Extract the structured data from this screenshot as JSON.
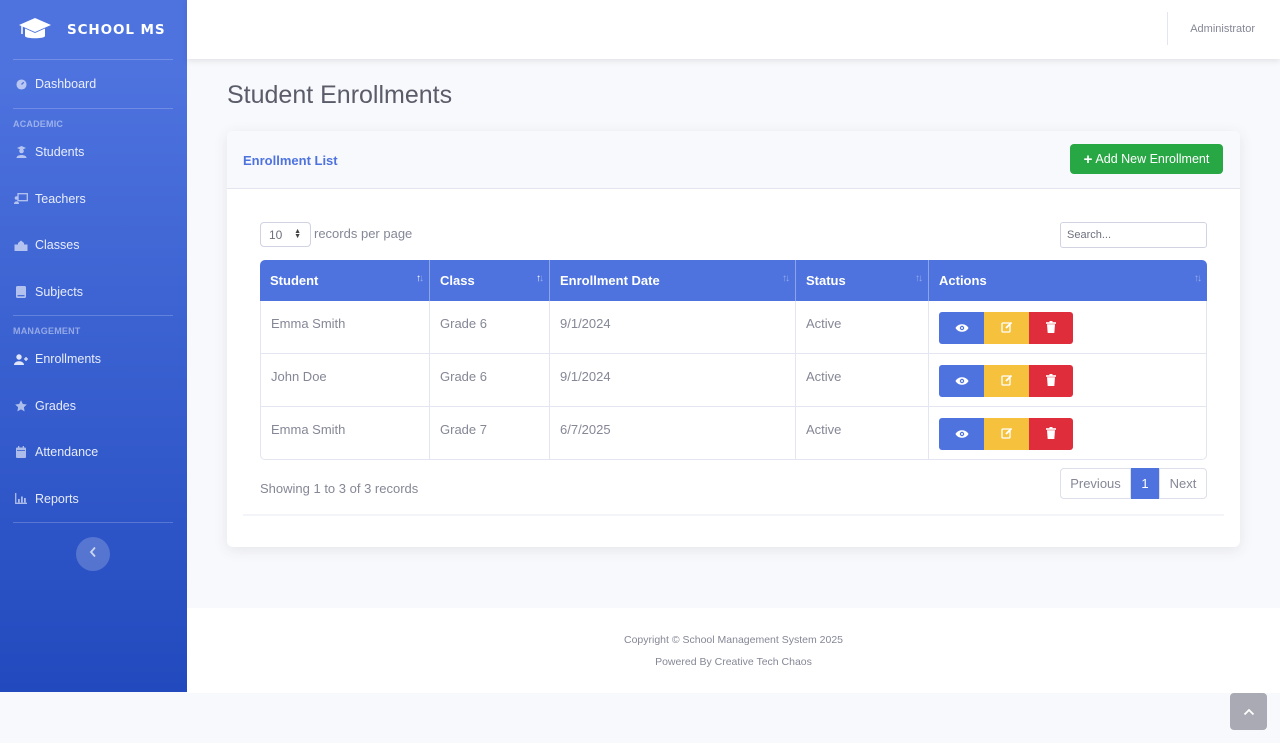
{
  "brand": {
    "name": "SCHOOL MS",
    "icon": "graduation-cap-icon"
  },
  "sidebar": {
    "dashboard": {
      "label": "Dashboard",
      "icon": "dashboard-icon"
    },
    "sections": [
      {
        "heading": "ACADEMIC",
        "items": [
          {
            "label": "Students",
            "icon": "user-graduate-icon"
          },
          {
            "label": "Teachers",
            "icon": "chalkboard-teacher-icon"
          },
          {
            "label": "Classes",
            "icon": "school-icon"
          },
          {
            "label": "Subjects",
            "icon": "book-icon"
          }
        ]
      },
      {
        "heading": "MANAGEMENT",
        "items": [
          {
            "label": "Enrollments",
            "icon": "user-plus-icon"
          },
          {
            "label": "Grades",
            "icon": "star-icon"
          },
          {
            "label": "Attendance",
            "icon": "calendar-icon"
          },
          {
            "label": "Reports",
            "icon": "chart-icon"
          }
        ]
      }
    ]
  },
  "topbar": {
    "user": "Administrator"
  },
  "page": {
    "title": "Student Enrollments"
  },
  "card": {
    "title": "Enrollment List",
    "add_button": "Add New Enrollment",
    "length_value": "10",
    "length_label": "records per page",
    "search_placeholder": "Search...",
    "columns": [
      "Student",
      "Class",
      "Enrollment Date",
      "Status",
      "Actions"
    ],
    "rows": [
      {
        "student": "Emma Smith",
        "class": "Grade 6",
        "date": "9/1/2024",
        "status": "Active"
      },
      {
        "student": "John Doe",
        "class": "Grade 6",
        "date": "9/1/2024",
        "status": "Active"
      },
      {
        "student": "Emma Smith",
        "class": "Grade 7",
        "date": "6/7/2025",
        "status": "Active"
      }
    ],
    "info": "Showing 1 to 3 of 3 records",
    "pagination": {
      "previous": "Previous",
      "current": "1",
      "next": "Next"
    }
  },
  "footer": {
    "copyright": "Copyright © School Management System 2025",
    "powered": "Powered By Creative Tech Chaos"
  },
  "colors": {
    "primary": "#4e73df",
    "success": "#28a745",
    "warning": "#f6c23e",
    "danger": "#e02d3c"
  }
}
